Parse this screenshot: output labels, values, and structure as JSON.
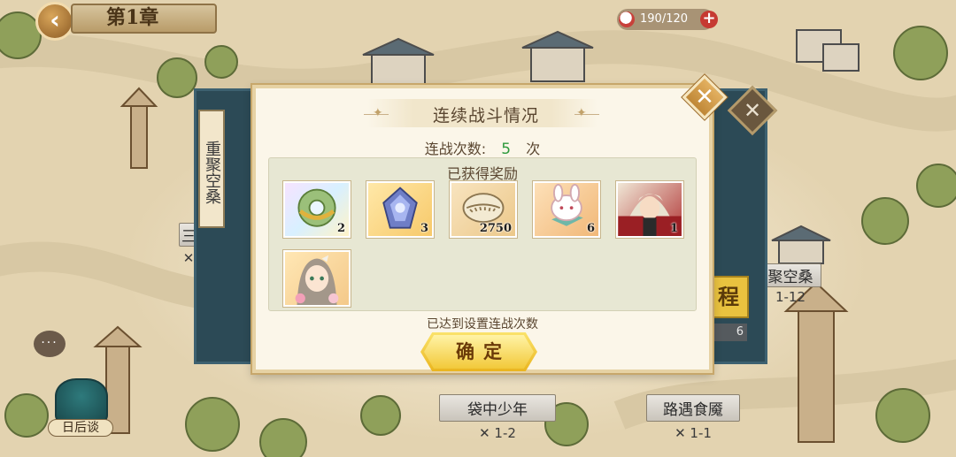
{
  "header": {
    "chapter_title": "第1章",
    "back_glyph": "‹"
  },
  "stamina": {
    "value": "190/120",
    "plus": "+"
  },
  "side_panel": {
    "tab_label": "重聚空桑"
  },
  "map_levels": [
    {
      "name": "袋中少年",
      "code": "1-2"
    },
    {
      "name": "路遇食魇",
      "code": "1-1"
    },
    {
      "name": "聚空桑",
      "code": "1-12"
    }
  ],
  "map_partial": {
    "left_plate": "三",
    "go_label": "程",
    "go_count": "6"
  },
  "chat": {
    "icon_text": "···"
  },
  "story": {
    "label": "日后谈"
  },
  "dialog": {
    "title": "连续战斗情况",
    "battle_count_label": "连战次数:",
    "battle_count_value": "5",
    "battle_count_unit": "次",
    "rewards_title": "已获得奖励",
    "rewards": [
      {
        "icon": "jade-ring-icon",
        "qty": "2"
      },
      {
        "icon": "crystal-icon",
        "qty": "3"
      },
      {
        "icon": "shell-coin-icon",
        "qty": "2750"
      },
      {
        "icon": "bunny-pet-icon",
        "qty": "6"
      },
      {
        "icon": "character-portrait-icon",
        "qty": "1"
      },
      {
        "icon": "character-portrait-girl-icon",
        "qty": ""
      }
    ],
    "status": "已达到设置连战次数",
    "confirm_label": "确定",
    "close_glyph": "✕"
  },
  "colors": {
    "accent_green": "#2e9a3c",
    "button_gold": "#eab51f",
    "panel_teal": "#2c4a56"
  }
}
